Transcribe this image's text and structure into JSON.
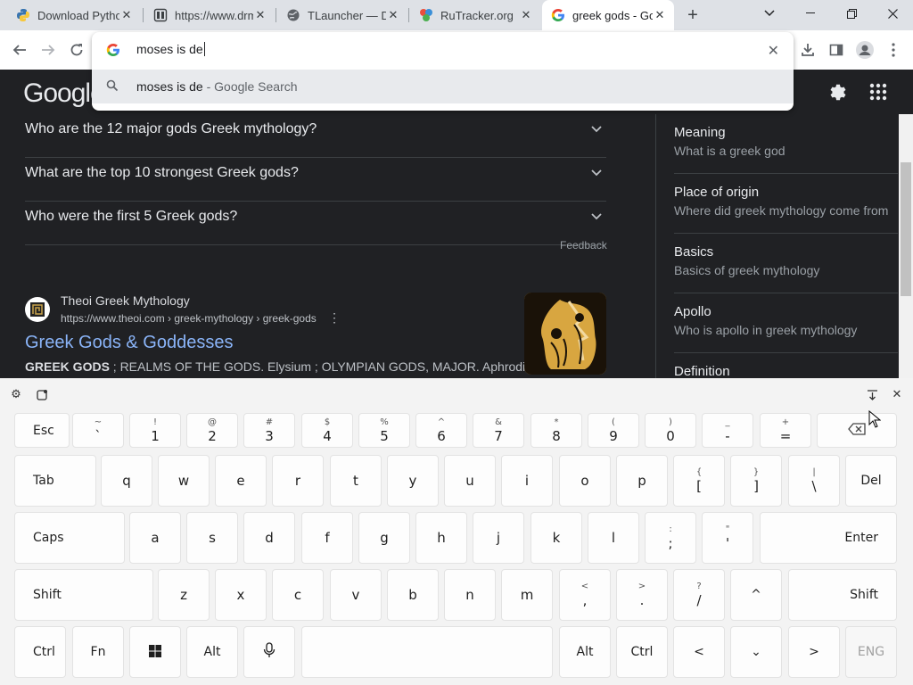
{
  "browser": {
    "tabs": [
      {
        "title": "Download Pytho",
        "icon": "python-icon"
      },
      {
        "title": "https://www.drm",
        "icon": "page-icon"
      },
      {
        "title": "TLauncher — Dl",
        "icon": "globe-icon"
      },
      {
        "title": "RuTracker.org",
        "icon": "rutracker-icon"
      },
      {
        "title": "greek gods - Go",
        "icon": "google-icon",
        "active": true
      }
    ],
    "omnibox_text": "moses is de",
    "suggestion_text": "moses is de",
    "suggestion_suffix": " - Google Search"
  },
  "google": {
    "logo_text": "Google",
    "paa": [
      {
        "question": "Who are the 12 major gods Greek mythology?"
      },
      {
        "question": "What are the top 10 strongest Greek gods?"
      },
      {
        "question": "Who were the first 5 Greek gods?"
      }
    ],
    "feedback_label": "Feedback",
    "result": {
      "site_name": "Theoi Greek Mythology",
      "url": "https://www.theoi.com › greek-mythology › greek-gods",
      "title": "Greek Gods & Goddesses",
      "snippet_bold": "GREEK GODS",
      "snippet_rest": " ; REALMS OF THE GODS. Elysium ; OLYMPIAN GODS, MAJOR. Aphrodite ;"
    },
    "knowledge_panel": [
      {
        "title": "Meaning",
        "subtitle": "What is a greek god"
      },
      {
        "title": "Place of origin",
        "subtitle": "Where did greek mythology come from"
      },
      {
        "title": "Basics",
        "subtitle": "Basics of greek mythology"
      },
      {
        "title": "Apollo",
        "subtitle": "Who is apollo in greek mythology"
      },
      {
        "title": "Definition",
        "subtitle": ""
      }
    ]
  },
  "keyboard": {
    "row1": [
      {
        "main": "Esc",
        "type": "label"
      },
      {
        "sec": "~",
        "main": "`"
      },
      {
        "sec": "!",
        "main": "1"
      },
      {
        "sec": "@",
        "main": "2"
      },
      {
        "sec": "#",
        "main": "3"
      },
      {
        "sec": "$",
        "main": "4"
      },
      {
        "sec": "%",
        "main": "5"
      },
      {
        "sec": "^",
        "main": "6"
      },
      {
        "sec": "&",
        "main": "7"
      },
      {
        "sec": "*",
        "main": "8"
      },
      {
        "sec": "(",
        "main": "9"
      },
      {
        "sec": ")",
        "main": "0"
      },
      {
        "sec": "_",
        "main": "-"
      },
      {
        "sec": "+",
        "main": "="
      },
      {
        "main": "",
        "type": "icon",
        "icon": "backspace-icon"
      }
    ],
    "row2": [
      {
        "main": "Tab",
        "type": "label"
      },
      {
        "main": "q"
      },
      {
        "main": "w"
      },
      {
        "main": "e"
      },
      {
        "main": "r"
      },
      {
        "main": "t"
      },
      {
        "main": "y"
      },
      {
        "main": "u"
      },
      {
        "main": "i"
      },
      {
        "main": "o"
      },
      {
        "main": "p"
      },
      {
        "sec": "{",
        "main": "["
      },
      {
        "sec": "}",
        "main": "]"
      },
      {
        "sec": "|",
        "main": "\\"
      },
      {
        "main": "Del",
        "type": "label"
      }
    ],
    "row3": [
      {
        "main": "Caps",
        "type": "label"
      },
      {
        "main": "a"
      },
      {
        "main": "s"
      },
      {
        "main": "d"
      },
      {
        "main": "f"
      },
      {
        "main": "g"
      },
      {
        "main": "h"
      },
      {
        "main": "j"
      },
      {
        "main": "k"
      },
      {
        "main": "l"
      },
      {
        "sec": ":",
        "main": ";"
      },
      {
        "sec": "\"",
        "main": "'"
      },
      {
        "main": "Enter",
        "type": "label"
      }
    ],
    "row4": [
      {
        "main": "Shift",
        "type": "label"
      },
      {
        "main": "z"
      },
      {
        "main": "x"
      },
      {
        "main": "c"
      },
      {
        "main": "v"
      },
      {
        "main": "b"
      },
      {
        "main": "n"
      },
      {
        "main": "m"
      },
      {
        "sec": "<",
        "main": ","
      },
      {
        "sec": ">",
        "main": "."
      },
      {
        "sec": "?",
        "main": "/"
      },
      {
        "main": "^",
        "type": "label"
      },
      {
        "main": "Shift",
        "type": "label"
      }
    ],
    "row5": [
      {
        "main": "Ctrl",
        "type": "label"
      },
      {
        "main": "Fn",
        "type": "label"
      },
      {
        "main": "",
        "type": "icon",
        "icon": "windows-icon"
      },
      {
        "main": "Alt",
        "type": "label"
      },
      {
        "main": "",
        "type": "icon",
        "icon": "microphone-icon"
      },
      {
        "main": "",
        "type": "label"
      },
      {
        "main": "Alt",
        "type": "label"
      },
      {
        "main": "Ctrl",
        "type": "label"
      },
      {
        "main": "<",
        "type": "label"
      },
      {
        "main": "⌄",
        "type": "label"
      },
      {
        "main": ">",
        "type": "label"
      },
      {
        "main": "ENG",
        "type": "label",
        "dim": true
      }
    ]
  }
}
